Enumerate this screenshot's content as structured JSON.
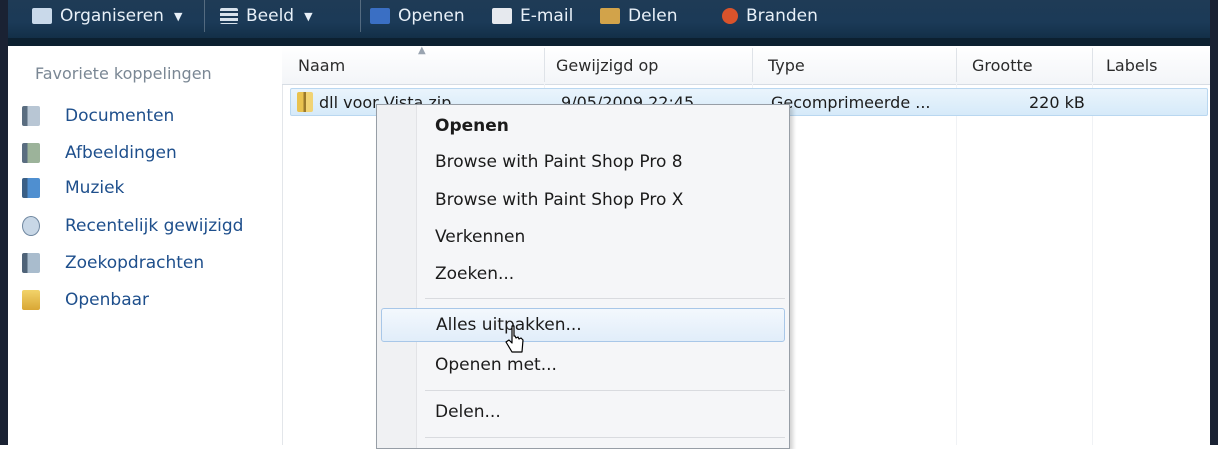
{
  "toolbar": {
    "items": [
      {
        "label": "Organiseren",
        "icon": "organize-icon",
        "color": "#c9d9ea"
      },
      {
        "label": "Beeld",
        "icon": "view-icon",
        "color": "#d8e2ec"
      },
      {
        "label": "Openen",
        "icon": "open-icon",
        "color": "#3a6fc4"
      },
      {
        "label": "E-mail",
        "icon": "email-icon",
        "color": "#e6e9ee"
      },
      {
        "label": "Delen",
        "icon": "share-icon",
        "color": "#d2a34a"
      },
      {
        "label": "Branden",
        "icon": "burn-icon",
        "color": "#d9532b"
      }
    ]
  },
  "nav": {
    "title": "Favoriete koppelingen",
    "items": [
      {
        "label": "Documenten",
        "icon": "documents-icon"
      },
      {
        "label": "Afbeeldingen",
        "icon": "pictures-icon"
      },
      {
        "label": "Muziek",
        "icon": "music-icon"
      },
      {
        "label": "Recentelijk gewijzigd",
        "icon": "recent-icon"
      },
      {
        "label": "Zoekopdrachten",
        "icon": "searches-icon"
      },
      {
        "label": "Openbaar",
        "icon": "public-folder-icon"
      }
    ]
  },
  "columns": [
    "Naam",
    "Gewijzigd op",
    "Type",
    "Grootte",
    "Labels"
  ],
  "file": {
    "name": "dll voor Vista.zip",
    "modified": "9/05/2009 22:45",
    "type": "Gecomprimeerde ...",
    "size": "220 kB"
  },
  "context_menu": {
    "items": [
      {
        "label": "Openen",
        "bold": true
      },
      {
        "label": "Browse with Paint Shop Pro 8"
      },
      {
        "label": "Browse with Paint Shop Pro X"
      },
      {
        "label": "Verkennen"
      },
      {
        "label": "Zoeken..."
      },
      {
        "label": "Alles uitpakken...",
        "highlighted": true
      },
      {
        "label": "Openen met..."
      },
      {
        "label": "Delen..."
      }
    ]
  }
}
